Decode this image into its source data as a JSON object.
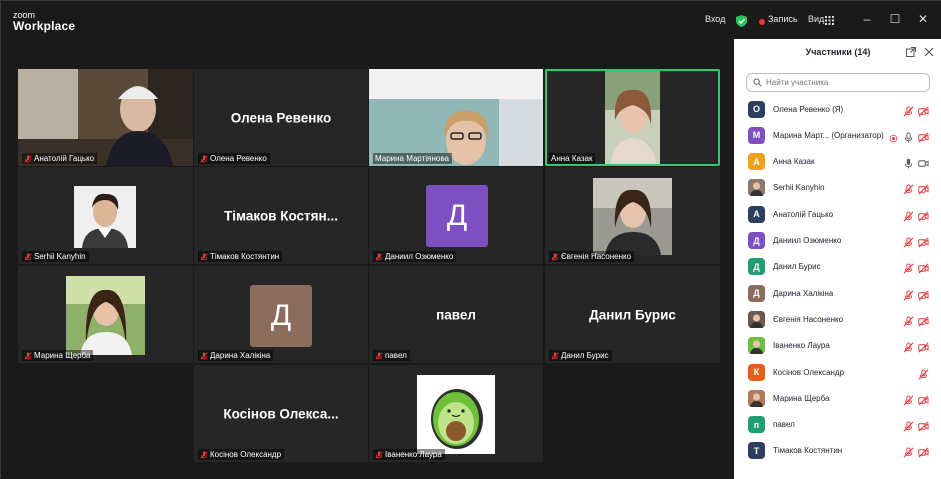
{
  "app": {
    "logo_line1": "zoom",
    "logo_line2": "Workplace"
  },
  "titlebar": {
    "enter_label": "Вход",
    "record_label": "Запись",
    "view_label": "Вид"
  },
  "panel": {
    "title": "Участники (14)",
    "search_placeholder": "Найти участника",
    "participants": [
      {
        "name": "Олена Ревенко (Я)",
        "initial": "О",
        "color": "#2d3f5e",
        "mic": "off",
        "video": "off"
      },
      {
        "name": "Марина Март... (Организатор)",
        "initial": "М",
        "color": "#7e4fc0",
        "mic": "on",
        "video": "off",
        "host": true
      },
      {
        "name": "Анна Казак",
        "initial": "А",
        "color": "#f0a21c",
        "mic": "on",
        "video": "on"
      },
      {
        "name": "Serhii Kanyhin",
        "initial": "",
        "color": "#8a7a6a",
        "mic": "off",
        "video": "off",
        "photo": true
      },
      {
        "name": "Анатолій Гацько",
        "initial": "А",
        "color": "#2d3f5e",
        "mic": "off",
        "video": "off"
      },
      {
        "name": "Даниил Озюменко",
        "initial": "Д",
        "color": "#7e4fc0",
        "mic": "off",
        "video": "off"
      },
      {
        "name": "Данил Бурис",
        "initial": "Д",
        "color": "#1f9e73",
        "mic": "off",
        "video": "off"
      },
      {
        "name": "Дарина Халікіна",
        "initial": "Д",
        "color": "#8c6c5c",
        "mic": "off",
        "video": "off"
      },
      {
        "name": "Євгенія Насоненко",
        "initial": "",
        "color": "#6a5a50",
        "mic": "off",
        "video": "off",
        "photo": true
      },
      {
        "name": "Іваненко Лаура",
        "initial": "",
        "color": "#6fbf3a",
        "mic": "off",
        "video": "off",
        "photo": true
      },
      {
        "name": "Косінов Олександр",
        "initial": "К",
        "color": "#e0611a",
        "mic": "off",
        "video": "none"
      },
      {
        "name": "Марина Щерба",
        "initial": "",
        "color": "#b07a5a",
        "mic": "off",
        "video": "off",
        "photo": true
      },
      {
        "name": "павел",
        "initial": "п",
        "color": "#1f9e73",
        "mic": "off",
        "video": "off"
      },
      {
        "name": "Тімаков Костянтин",
        "initial": "Т",
        "color": "#2d3f5e",
        "mic": "off",
        "video": "off"
      }
    ]
  },
  "tiles": [
    {
      "label": "Анатолій Гацько",
      "kind": "photo",
      "photo": "man-office"
    },
    {
      "label": "Олена Ревенко",
      "kind": "name",
      "big": "Олена Ревенко"
    },
    {
      "label": "Марина Мартіянова",
      "kind": "photo",
      "photo": "woman-glasses",
      "mic": "none"
    },
    {
      "label": "Анна Казак",
      "kind": "photo",
      "photo": "woman-video",
      "mic": "none",
      "active": true
    },
    {
      "label": "Serhii Kanyhin",
      "kind": "photo-small",
      "photo": "man-young"
    },
    {
      "label": "Тімаков Костянтин",
      "kind": "name",
      "big": "Тімаков  Костян..."
    },
    {
      "label": "Даниил Озюменко",
      "kind": "avatar",
      "initial": "Д",
      "color": "#7e4fc0"
    },
    {
      "label": "Євгенія Насоненко",
      "kind": "photo-small",
      "photo": "woman-dark"
    },
    {
      "label": "Марина Щерба",
      "kind": "photo-small",
      "photo": "woman-long-hair"
    },
    {
      "label": "Дарина Халікіна",
      "kind": "avatar",
      "initial": "Д",
      "color": "#8c6c5c"
    },
    {
      "label": "павел",
      "kind": "name",
      "big": "павел"
    },
    {
      "label": "Данил Бурис",
      "kind": "name",
      "big": "Данил Бурис"
    },
    {
      "label": "Косінов Олександр",
      "kind": "name",
      "big": "Косінов  Олекса..."
    },
    {
      "label": "Іваненко Лаура",
      "kind": "photo-small",
      "photo": "avocado"
    }
  ]
}
